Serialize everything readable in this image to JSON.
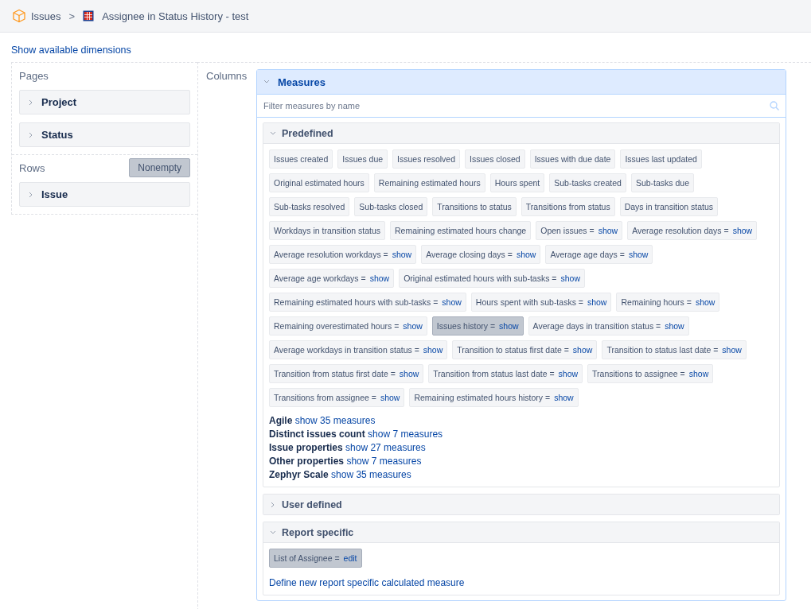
{
  "breadcrumb": {
    "root": "Issues",
    "separator": ">",
    "report": "Assignee in Status History - test"
  },
  "dimensions_link": "Show available dimensions",
  "pages": {
    "title": "Pages",
    "items": [
      {
        "label": "Project",
        "expanded": false
      },
      {
        "label": "Status",
        "expanded": false
      }
    ]
  },
  "rows": {
    "title": "Rows",
    "nonempty": {
      "label": "Nonempty",
      "on": true
    },
    "items": [
      {
        "label": "Issue",
        "expanded": false
      }
    ]
  },
  "columns": {
    "title": "Columns"
  },
  "measures": {
    "title": "Measures",
    "expanded": true,
    "filter": {
      "placeholder": "Filter measures by name"
    },
    "sections": [
      {
        "title": "Predefined",
        "expanded": true,
        "chips": [
          {
            "label": "Issues created",
            "selected": false
          },
          {
            "label": "Issues due",
            "selected": false
          },
          {
            "label": "Issues resolved",
            "selected": false
          },
          {
            "label": "Issues closed",
            "selected": false
          },
          {
            "label": "Issues with due date",
            "selected": false
          },
          {
            "label": "Issues last updated",
            "selected": false
          },
          {
            "label": "Original estimated hours",
            "selected": false
          },
          {
            "label": "Remaining estimated hours",
            "selected": false
          },
          {
            "label": "Hours spent",
            "selected": false
          },
          {
            "label": "Sub-tasks created",
            "selected": false
          },
          {
            "label": "Sub-tasks due",
            "selected": false
          },
          {
            "label": "Sub-tasks resolved",
            "selected": false
          },
          {
            "label": "Sub-tasks closed",
            "selected": false
          },
          {
            "label": "Transitions to status",
            "selected": false
          },
          {
            "label": "Transitions from status",
            "selected": false
          },
          {
            "label": "Days in transition status",
            "selected": false
          },
          {
            "label": "Workdays in transition status",
            "selected": false
          },
          {
            "label": "Remaining estimated hours change",
            "selected": false
          },
          {
            "label": "Open issues",
            "sep": "=",
            "action": "show",
            "selected": false
          },
          {
            "label": "Average resolution days",
            "sep": "=",
            "action": "show",
            "selected": false
          },
          {
            "label": "Average resolution workdays",
            "sep": "=",
            "action": "show",
            "selected": false
          },
          {
            "label": "Average closing days",
            "sep": "=",
            "action": "show",
            "selected": false
          },
          {
            "label": "Average age days",
            "sep": "=",
            "action": "show",
            "selected": false
          },
          {
            "label": "Average age workdays",
            "sep": "=",
            "action": "show",
            "selected": false
          },
          {
            "label": "Original estimated hours with sub-tasks",
            "sep": "=",
            "action": "show",
            "selected": false
          },
          {
            "label": "Remaining estimated hours with sub-tasks",
            "sep": "=",
            "action": "show",
            "selected": false
          },
          {
            "label": "Hours spent with sub-tasks",
            "sep": "=",
            "action": "show",
            "selected": false
          },
          {
            "label": "Remaining hours",
            "sep": "=",
            "action": "show",
            "selected": false
          },
          {
            "label": "Remaining overestimated hours",
            "sep": "=",
            "action": "show",
            "selected": false
          },
          {
            "label": "Issues history",
            "sep": "=",
            "action": "show",
            "selected": true
          },
          {
            "label": "Average days in transition status",
            "sep": "=",
            "action": "show",
            "selected": false
          },
          {
            "label": "Average workdays in transition status",
            "sep": "=",
            "action": "show",
            "selected": false
          },
          {
            "label": "Transition to status first date",
            "sep": "=",
            "action": "show",
            "selected": false
          },
          {
            "label": "Transition to status last date",
            "sep": "=",
            "action": "show",
            "selected": false
          },
          {
            "label": "Transition from status first date",
            "sep": "=",
            "action": "show",
            "selected": false
          },
          {
            "label": "Transition from status last date",
            "sep": "=",
            "action": "show",
            "selected": false
          },
          {
            "label": "Transitions to assignee",
            "sep": "=",
            "action": "show",
            "selected": false
          },
          {
            "label": "Transitions from assignee",
            "sep": "=",
            "action": "show",
            "selected": false
          },
          {
            "label": "Remaining estimated hours history",
            "sep": "=",
            "action": "show",
            "selected": false
          }
        ],
        "groups": [
          {
            "name": "Agile",
            "link": "show 35 measures"
          },
          {
            "name": "Distinct issues count",
            "link": "show 7 measures"
          },
          {
            "name": "Issue properties",
            "link": "show 27 measures"
          },
          {
            "name": "Other properties",
            "link": "show 7 measures"
          },
          {
            "name": "Zephyr Scale",
            "link": "show 35 measures"
          }
        ]
      },
      {
        "title": "User defined",
        "expanded": false
      },
      {
        "title": "Report specific",
        "expanded": true,
        "chips": [
          {
            "label": "List of Assignee",
            "sep": "=",
            "action": "edit",
            "selected": true
          }
        ],
        "footer_link": "Define new report specific calculated measure"
      }
    ]
  }
}
